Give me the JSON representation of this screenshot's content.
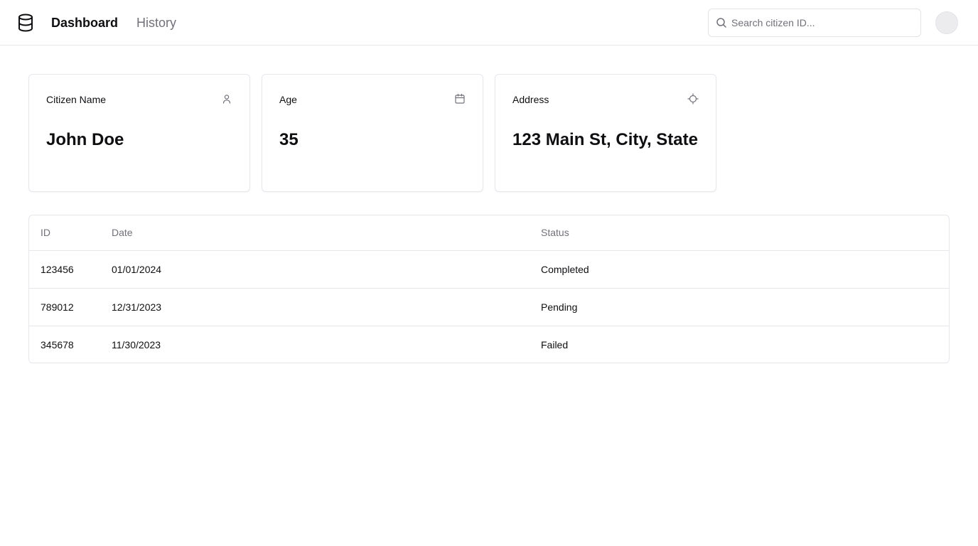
{
  "header": {
    "logo_icon": "database-icon",
    "nav": [
      {
        "label": "Dashboard",
        "active": true
      },
      {
        "label": "History",
        "active": false
      }
    ],
    "search": {
      "placeholder": "Search citizen ID...",
      "value": "",
      "icon": "search-icon"
    },
    "avatar_icon": "avatar"
  },
  "cards": [
    {
      "label": "Citizen Name",
      "value": "John Doe",
      "icon": "user-icon"
    },
    {
      "label": "Age",
      "value": "35",
      "icon": "calendar-icon"
    },
    {
      "label": "Address",
      "value": "123 Main St, City, State",
      "icon": "crosshair-icon"
    }
  ],
  "table": {
    "columns": [
      "ID",
      "Date",
      "Status"
    ],
    "rows": [
      {
        "id": "123456",
        "date": "01/01/2024",
        "status": "Completed"
      },
      {
        "id": "789012",
        "date": "12/31/2023",
        "status": "Pending"
      },
      {
        "id": "345678",
        "date": "11/30/2023",
        "status": "Failed"
      }
    ]
  },
  "colors": {
    "border": "#e5e7eb",
    "muted_text": "#71717a",
    "text": "#0f0f12"
  }
}
